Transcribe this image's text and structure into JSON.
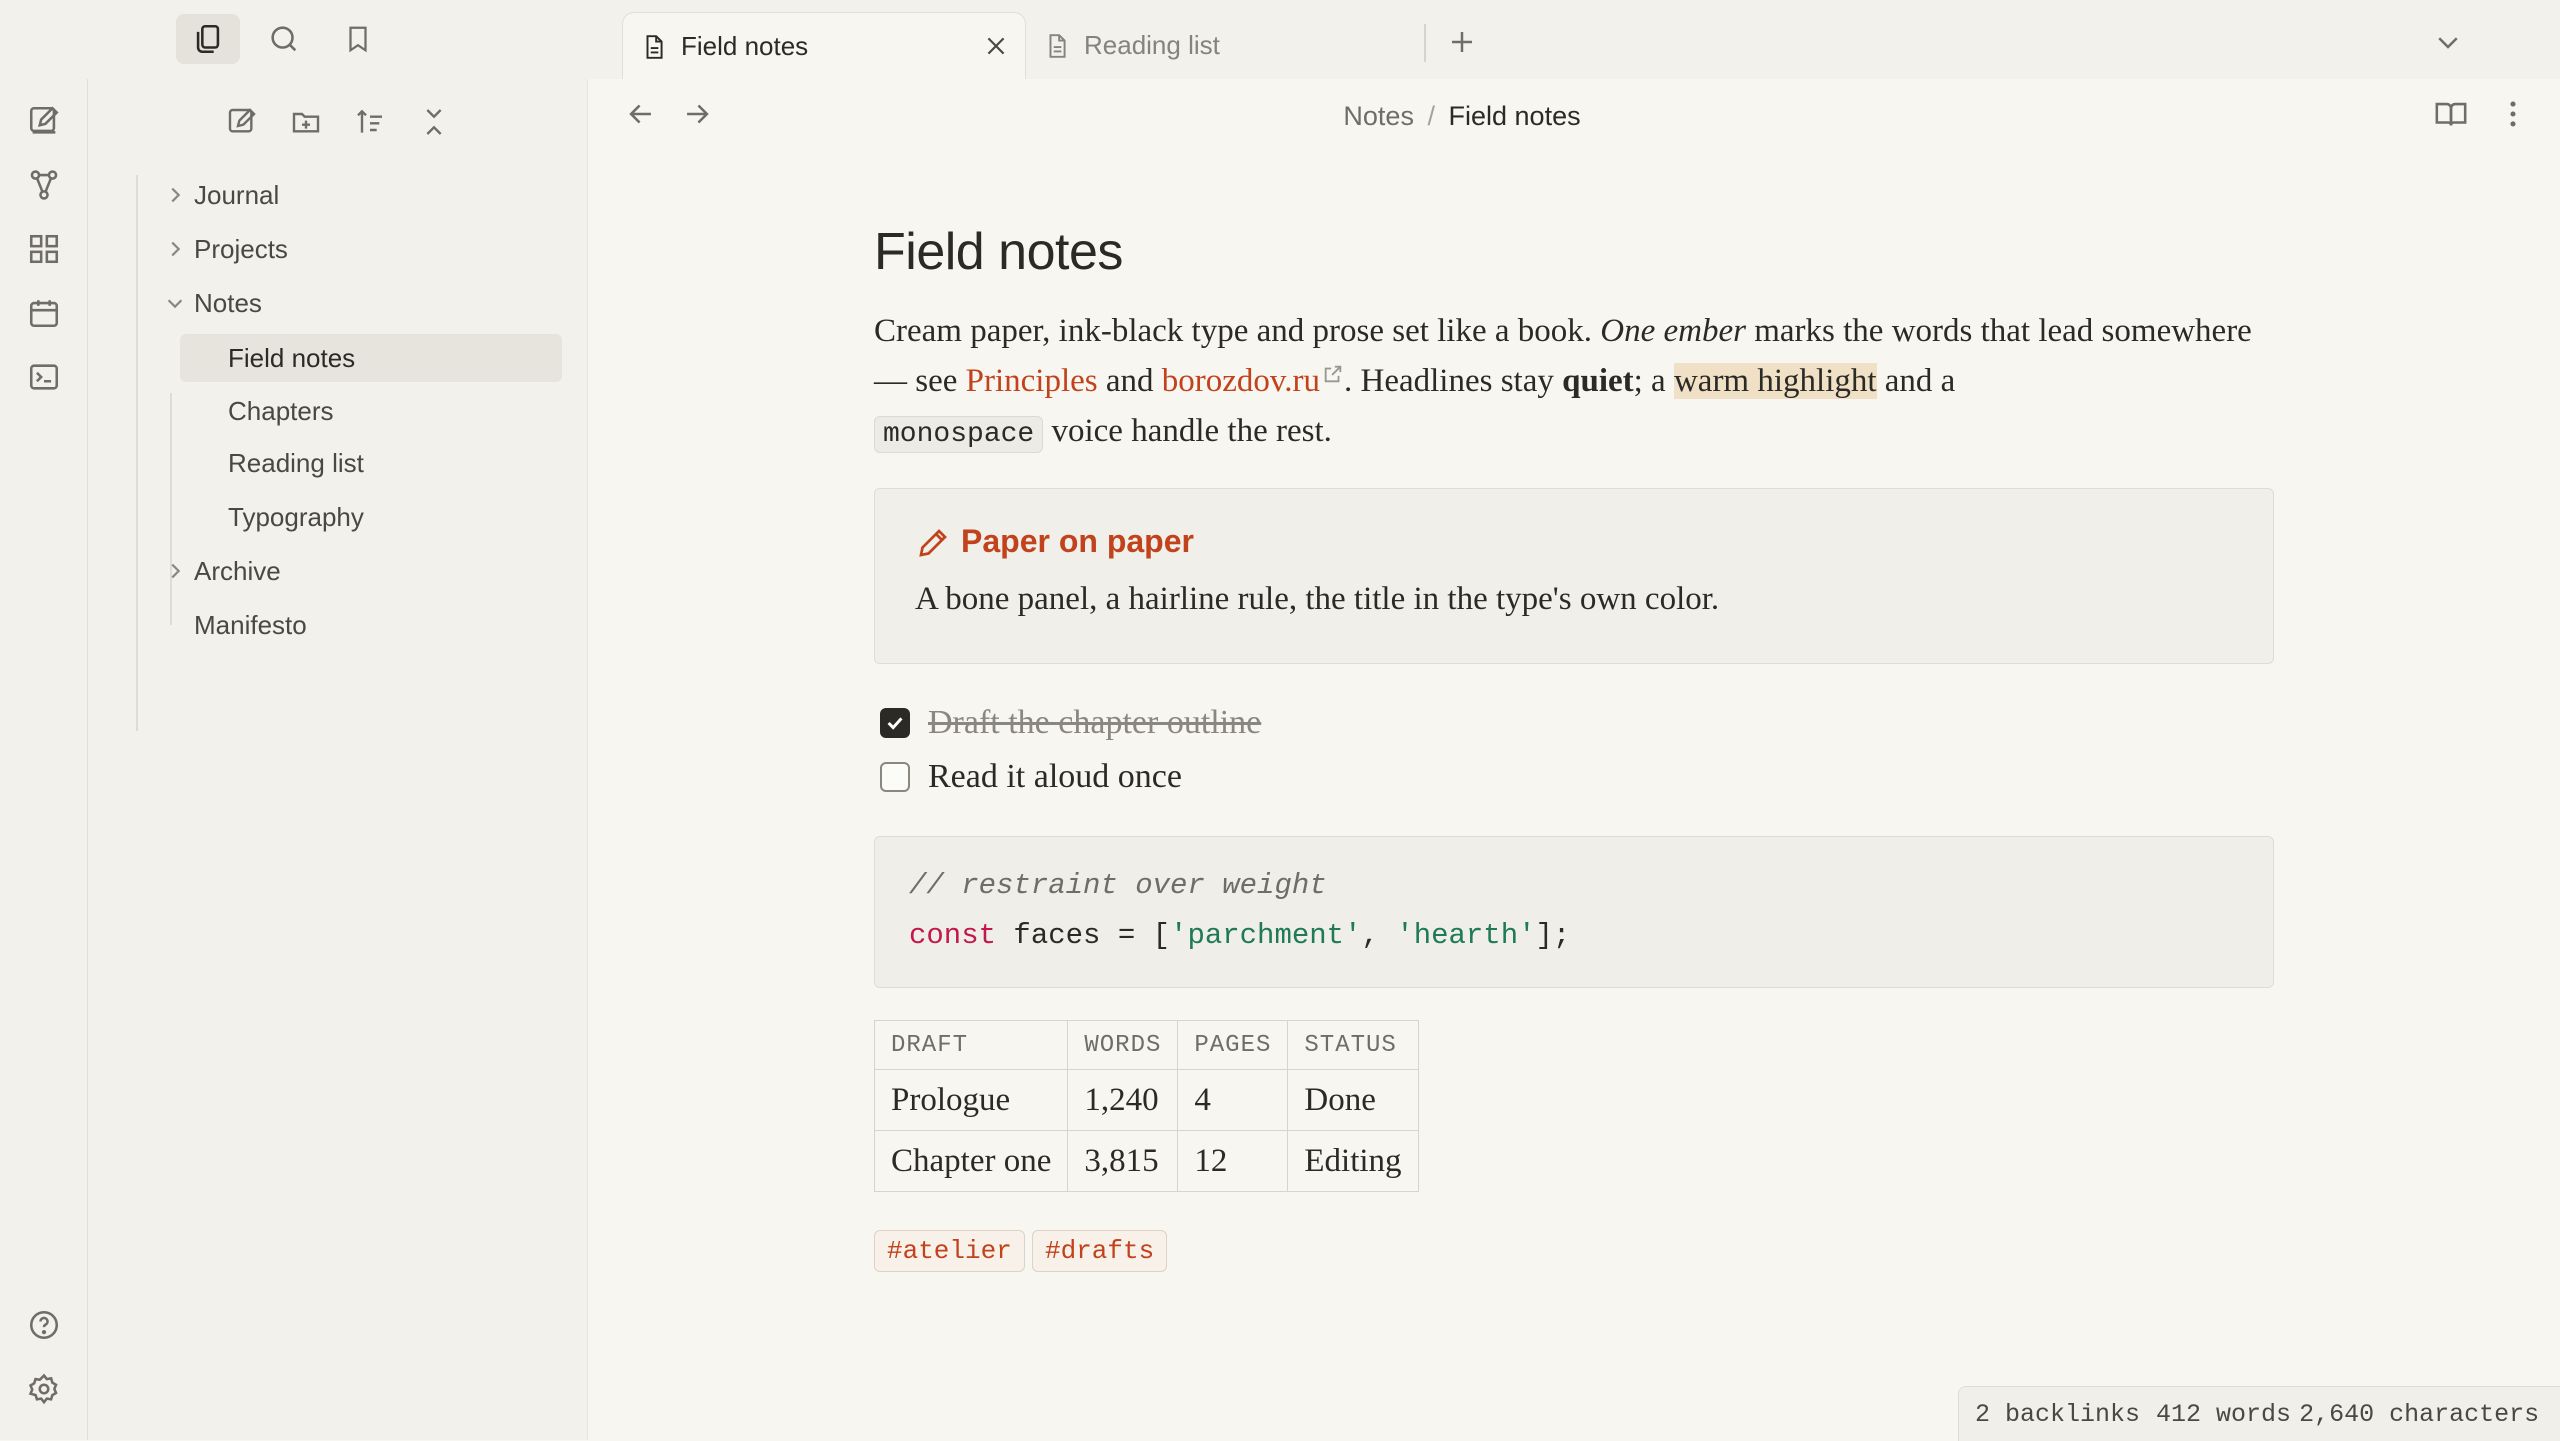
{
  "tabs": [
    {
      "label": "Field notes",
      "active": true
    },
    {
      "label": "Reading list",
      "active": false
    }
  ],
  "breadcrumb": {
    "parent": "Notes",
    "separator": "/",
    "current": "Field notes"
  },
  "sidebar": {
    "items": [
      {
        "label": "Journal",
        "type": "folder"
      },
      {
        "label": "Projects",
        "type": "folder"
      },
      {
        "label": "Notes",
        "type": "folder-open"
      },
      {
        "label": "Field notes",
        "type": "file",
        "selected": true
      },
      {
        "label": "Chapters",
        "type": "file"
      },
      {
        "label": "Reading list",
        "type": "file"
      },
      {
        "label": "Typography",
        "type": "file"
      },
      {
        "label": "Archive",
        "type": "folder"
      },
      {
        "label": "Manifesto",
        "type": "file"
      }
    ]
  },
  "doc": {
    "title": "Field notes",
    "p": {
      "t1": "Cream paper, ink-black type and prose set like a book. ",
      "em": "One ember",
      "t2": " marks the words that lead somewhere — see ",
      "link1": "Principles",
      "t3": " and ",
      "link2": "borozdov.ru",
      "t4": ". Headlines stay ",
      "strong": "quiet",
      "t5": "; a ",
      "highlight": "warm highlight",
      "t6": " and a ",
      "code": "monospace",
      "t7": " voice handle the rest."
    },
    "callout": {
      "title": "Paper on paper",
      "body": "A bone panel, a hairline rule, the title in the type's own color."
    },
    "tasks": [
      {
        "label": "Draft the chapter outline",
        "done": true
      },
      {
        "label": "Read it aloud once",
        "done": false
      }
    ],
    "code": {
      "comment": "// restraint over weight",
      "keyword": "const",
      "mid": " faces = [",
      "s1": "'parchment'",
      "comma": ", ",
      "s2": "'hearth'",
      "end": "];"
    },
    "table": {
      "headers": [
        "DRAFT",
        "WORDS",
        "PAGES",
        "STATUS"
      ],
      "rows": [
        [
          "Prologue",
          "1,240",
          "4",
          "Done"
        ],
        [
          "Chapter one",
          "3,815",
          "12",
          "Editing"
        ]
      ]
    },
    "tags": [
      "#atelier",
      "#drafts"
    ]
  },
  "status": {
    "backlinks": "2 backlinks",
    "words": "412 words",
    "characters": "2,640 characters"
  },
  "colors": {
    "accent": "#c2421b",
    "paper": "#f7f6f1",
    "panel": "#f2f1ec",
    "highlight": "#efe0c6",
    "ink": "#2b2a27"
  }
}
